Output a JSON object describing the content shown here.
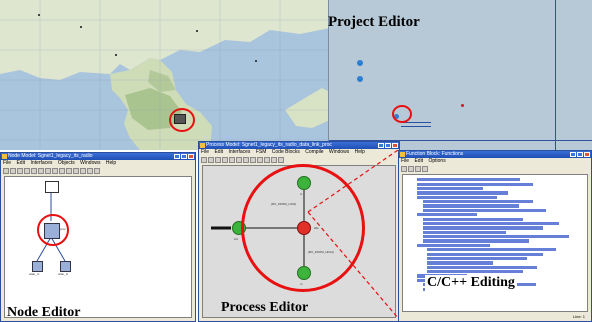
{
  "labels": {
    "project_editor": "Project Editor",
    "node_editor": "Node Editor",
    "process_editor": "Process Editor",
    "cpp_editing": "C/C++ Editing"
  },
  "node_window": {
    "title": "Node Model: Sgnet1_legacy_its_radio",
    "menu": [
      "File",
      "Edit",
      "Interfaces",
      "Objects",
      "Windows",
      "Help"
    ],
    "nodes": [
      "proc",
      "wlan_rx",
      "wlan_tx"
    ]
  },
  "process_window": {
    "title": "Process Model: Sgnet1_legacy_its_radio_data_link_proc",
    "menu": [
      "File",
      "Edit",
      "Interfaces",
      "FSM",
      "Code Blocks",
      "Compile",
      "Windows",
      "Help"
    ],
    "states": [
      "init",
      "idle",
      "tx",
      "rx"
    ],
    "transitions": [
      "(RX_FROM_LOW)",
      "(RX_FROM_HIGH)"
    ]
  },
  "code_window": {
    "title": "Function Block: Functions",
    "menu": [
      "File",
      "Edit",
      "Options"
    ],
    "status": "Line: 1"
  },
  "colors": {
    "highlight": "#e81010",
    "window_border": "#2a4fa0"
  }
}
